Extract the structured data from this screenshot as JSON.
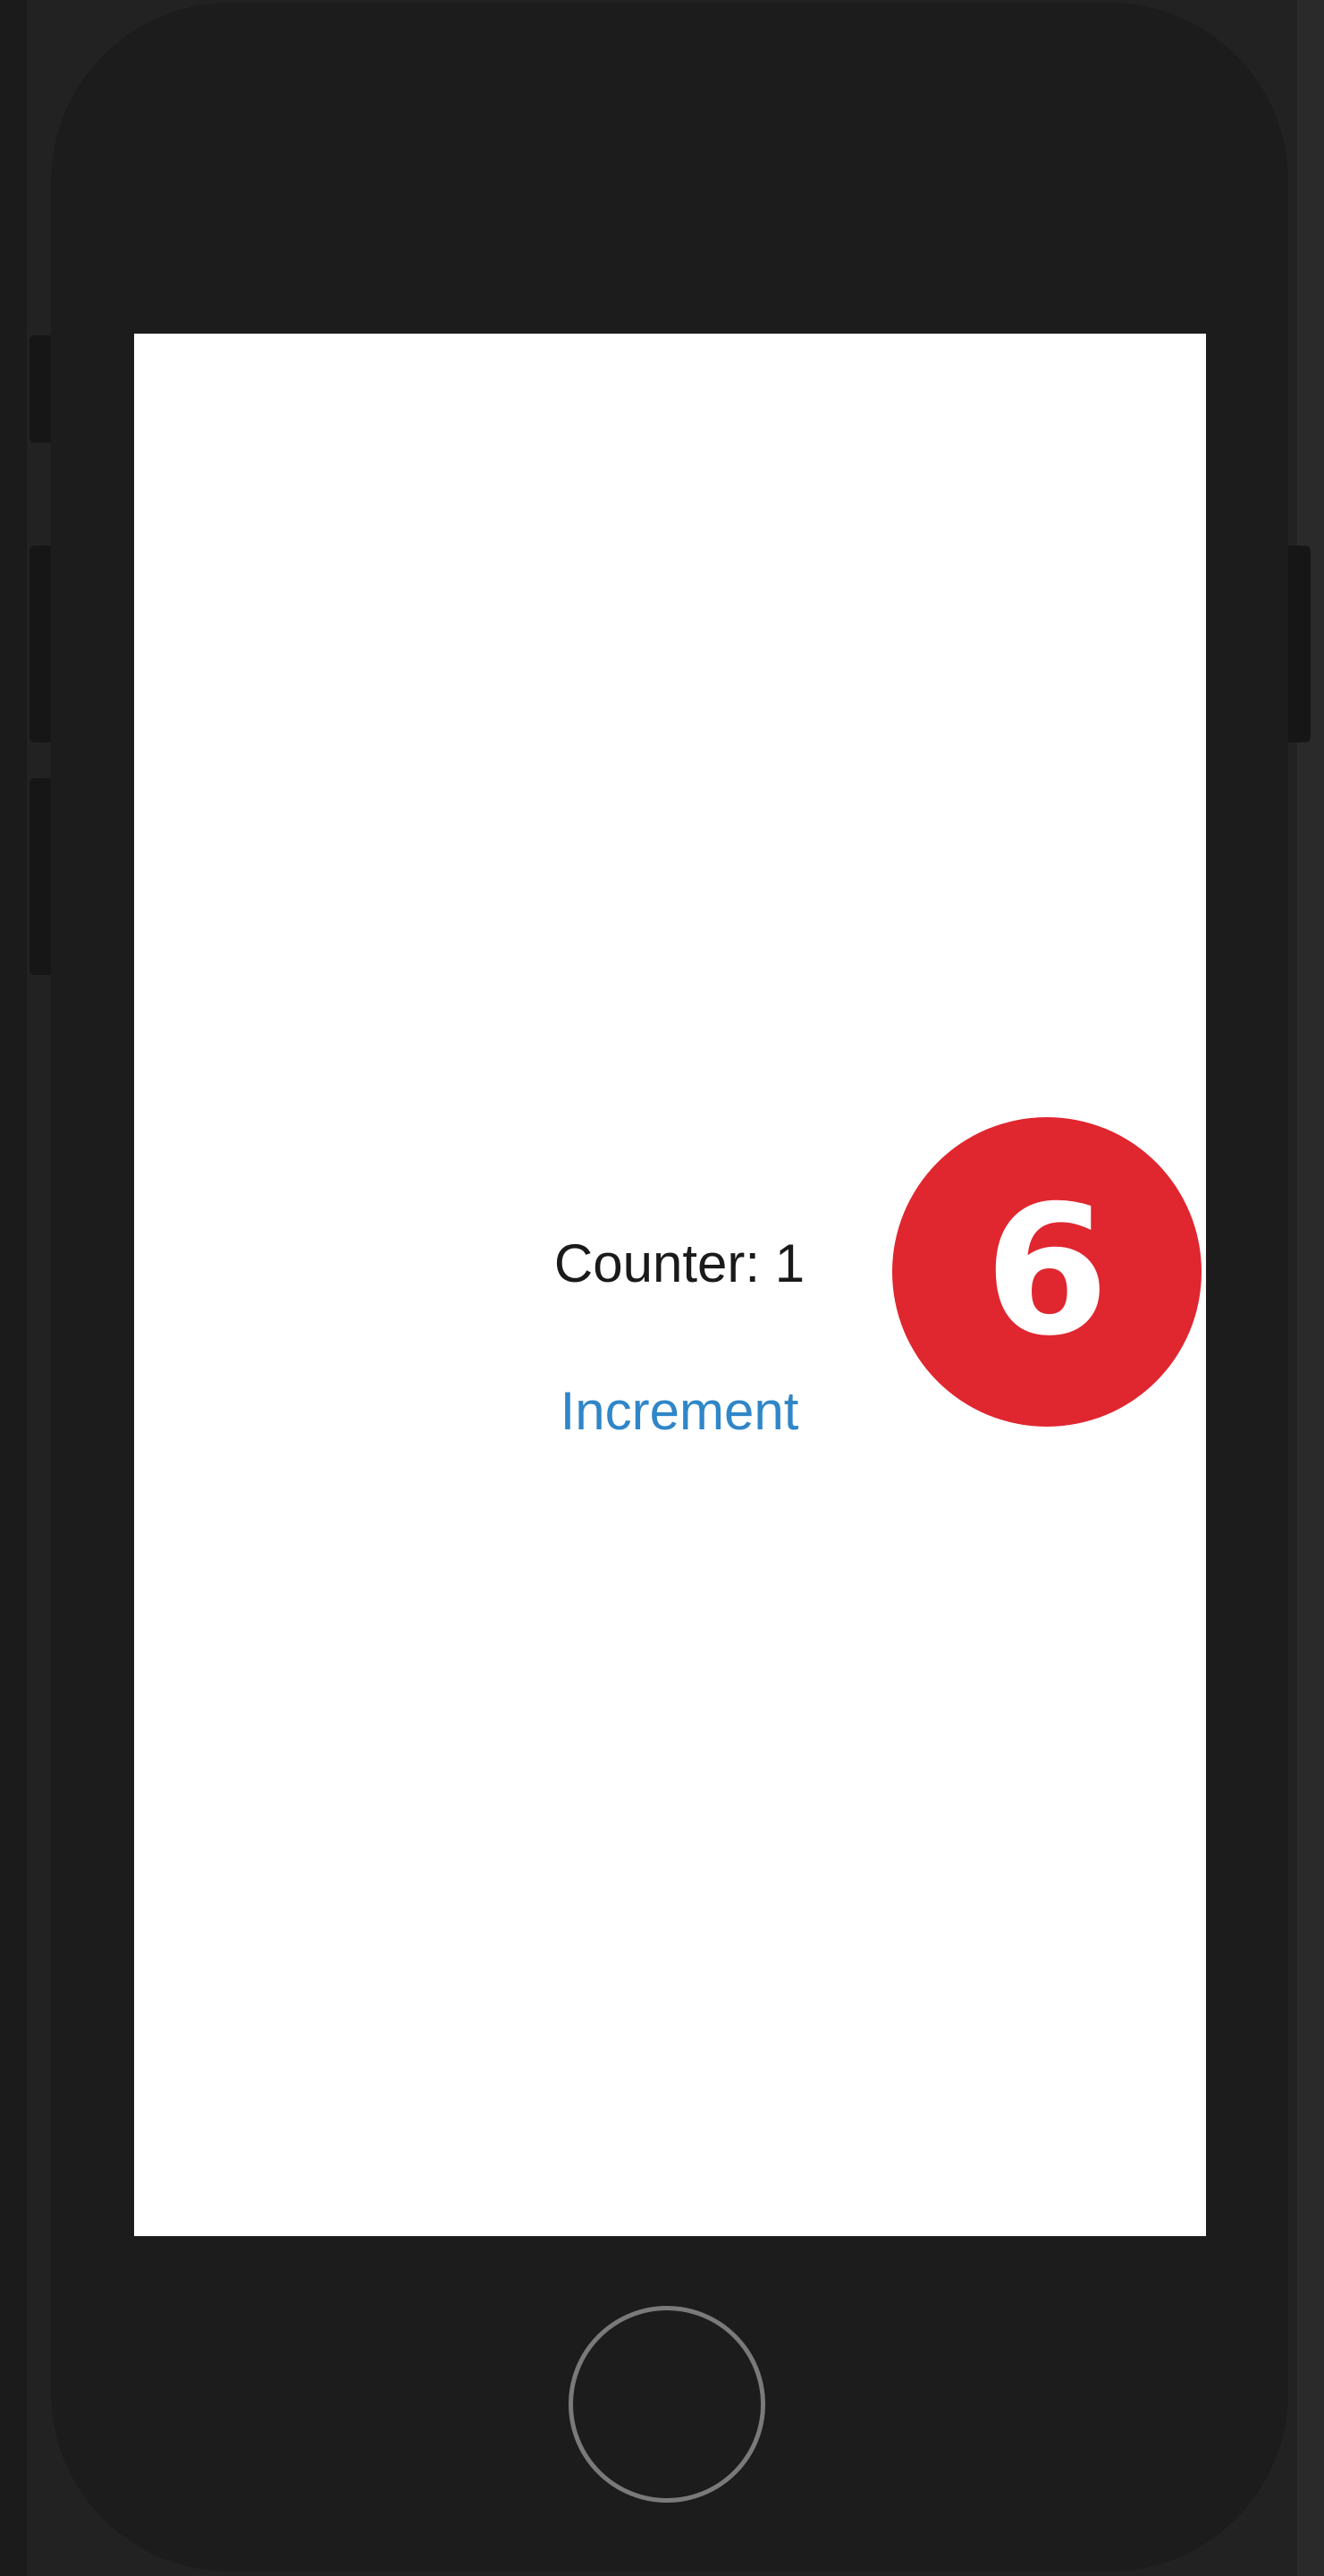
{
  "screen": {
    "counter_text": "Counter: 1",
    "increment_label": "Increment"
  },
  "annotation": {
    "step_number": "6",
    "badge_color": "#e0262f"
  },
  "colors": {
    "phone_body": "#1c1c1c",
    "screen_bg": "#ffffff",
    "button_text": "#2f86c8"
  },
  "icons": {
    "home": "home-button-circle"
  }
}
